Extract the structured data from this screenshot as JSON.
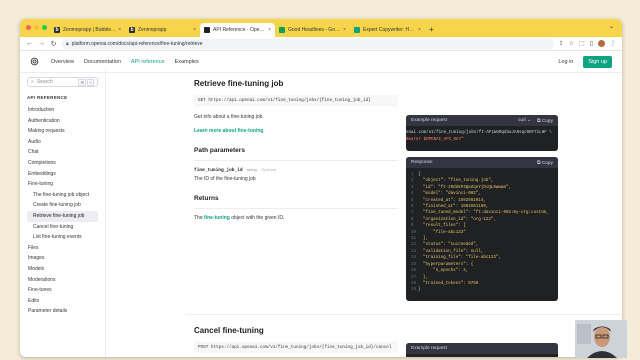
{
  "browser": {
    "tabs": [
      {
        "title": "Zenmoprapp | Bubble Editor",
        "fav": "b",
        "fav_color": "#2b2b2b"
      },
      {
        "title": "Zenmoprapp",
        "fav": "b",
        "fav_color": "#2b2b2b"
      },
      {
        "title": "API Reference - OpenAI API",
        "fav": "",
        "fav_color": "#202123"
      },
      {
        "title": "Good Headlines - Google Sheets",
        "fav": "",
        "fav_color": "#0f9d58"
      },
      {
        "title": "Expert Copywriter: Headline &...",
        "fav": "",
        "fav_color": "#10a37f"
      }
    ],
    "url": "platform.openai.com/docs/api-reference/fine-tuning/retrieve"
  },
  "header": {
    "nav": [
      "Overview",
      "Documentation",
      "API reference",
      "Examples"
    ],
    "login": "Log in",
    "signup": "Sign up",
    "accent": "#10a37f"
  },
  "sidebar": {
    "search_placeholder": "Search",
    "kbd": [
      "⌘",
      "K"
    ],
    "heading": "API REFERENCE",
    "items": [
      {
        "label": "Introduction"
      },
      {
        "label": "Authentication"
      },
      {
        "label": "Making requests"
      },
      {
        "label": "Audio"
      },
      {
        "label": "Chat"
      },
      {
        "label": "Completions"
      },
      {
        "label": "Embeddings"
      },
      {
        "label": "Fine-tuning"
      },
      {
        "label": "The fine-tuning job object",
        "sub": true
      },
      {
        "label": "Create fine-tuning job",
        "sub": true
      },
      {
        "label": "Retrieve fine-tuning job",
        "sub": true,
        "selected": true
      },
      {
        "label": "Cancel fine-tuning",
        "sub": true
      },
      {
        "label": "List fine-tuning events",
        "sub": true
      },
      {
        "label": "Files"
      },
      {
        "label": "Images"
      },
      {
        "label": "Models"
      },
      {
        "label": "Moderations"
      },
      {
        "label": "Fine-tunes"
      },
      {
        "label": "Edits"
      },
      {
        "label": "Parameter details"
      }
    ]
  },
  "doc": {
    "title": "Retrieve fine-tuning job",
    "endpoint": "GET https://api.openai.com/v1/fine_tuning/jobs/{fine_tuning_job_id}",
    "description": "Get info about a fine-tuning job.",
    "learn_more": "Learn more about fine-tuning",
    "path_params_title": "Path parameters",
    "param_name": "fine_tuning_job_id",
    "param_type": "string",
    "param_req": "Optional",
    "param_desc": "The ID of the fine-tuning job",
    "returns_title": "Returns",
    "returns_pre": "The ",
    "returns_link": "fine-tuning",
    "returns_post": " object with the given ID.",
    "next_title": "Cancel fine-tuning",
    "next_endpoint": "POST https://api.openai.com/v1/fine_tuning/jobs/{fine_tuning_job_id}/cancel"
  },
  "example_request": {
    "title": "Example request",
    "lang": "curl",
    "copy": "Copy",
    "line1": "enai.com/v1/fine_tuning/jobs/ft-AF1WoRqd3aJAHsqc9NY7iL8F \\",
    "line2": "Bearer $OPENAI_API_KEY\""
  },
  "response": {
    "title": "Response",
    "copy": "Copy",
    "lines": [
      "{",
      "  \"object\": \"fine_tuning.job\",",
      "  \"id\": \"ft-zRdUkP4QeZqeYjDcQL0wwam\",",
      "  \"model\": \"davinci-002\",",
      "  \"created_at\": 1692661014,",
      "  \"finished_at\": 1692661190,",
      "  \"fine_tuned_model\": \"ft:davinci-002:my-org:custom_",
      "  \"organization_id\": \"org-123\",",
      "  \"result_files\": [",
      "      \"file-abc123\"",
      "  ],",
      "  \"status\": \"succeeded\",",
      "  \"validation_file\": null,",
      "  \"training_file\": \"file-abc123\",",
      "  \"hyperparameters\": {",
      "      \"n_epochs\": 4,",
      "  },",
      "  \"trained_tokens\": 5768",
      "}"
    ]
  },
  "example_request2": {
    "title": "Example request"
  }
}
